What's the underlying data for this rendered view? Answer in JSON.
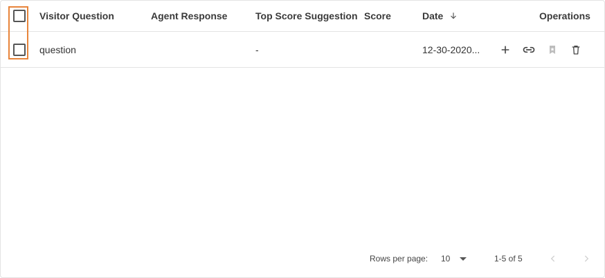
{
  "table": {
    "columns": {
      "visitor_question": "Visitor Question",
      "agent_response": "Agent Response",
      "top_score_suggestion": "Top Score Suggestion",
      "score": "Score",
      "date": "Date",
      "operations": "Operations"
    },
    "sort": {
      "column": "date",
      "direction": "descending",
      "icon": "arrow-down-icon"
    },
    "rows": [
      {
        "visitor_question": "question",
        "agent_response": "",
        "top_score_suggestion": "-",
        "score": "",
        "date": "12-30-2020...",
        "operations": [
          "plus-icon",
          "link-icon",
          "bookmark-icon",
          "trash-icon"
        ]
      }
    ]
  },
  "pagination": {
    "rows_per_page_label": "Rows per page:",
    "rows_per_page_value": "10",
    "range_text": "1-5 of 5"
  },
  "colors": {
    "highlight": "#e8843a",
    "border": "#e3e3e3",
    "icon": "#444444",
    "icon_disabled": "#bdbdbd"
  }
}
